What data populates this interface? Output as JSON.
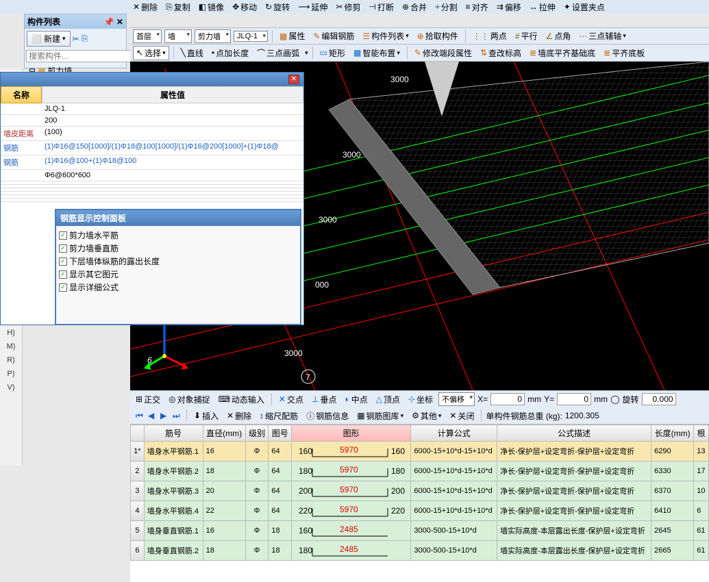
{
  "top_toolbar": {
    "items": [
      "删除",
      "复制",
      "镜像",
      "移动",
      "旋转",
      "延伸",
      "修剪",
      "打断",
      "合并",
      "分割",
      "对齐",
      "偏移",
      "拉伸",
      "设置夹点"
    ]
  },
  "side_panel": {
    "title": "构件列表",
    "new_btn": "新建",
    "search_placeholder": "搜索构件...",
    "tree_item": "剪力墙"
  },
  "toolbar2": {
    "combos": [
      "首层",
      "墙",
      "剪力墙",
      "JLQ-1"
    ],
    "buttons": [
      "属性",
      "编辑钢筋",
      "构件列表",
      "拾取构件"
    ],
    "right_buttons": [
      "两点",
      "平行",
      "点角",
      "三点辅轴"
    ]
  },
  "toolbar3": {
    "select": "选择",
    "items": [
      "直线",
      "点加长度",
      "三点画弧"
    ],
    "items2": [
      "矩形",
      "智能布置"
    ],
    "items3": [
      "修改端段属性",
      "查改标高",
      "墙底平齐基础底",
      "平齐底板"
    ]
  },
  "prop_panel": {
    "hdr_name": "名称",
    "hdr_val": "属性值",
    "rows": [
      {
        "name": "",
        "val": "JLQ-1",
        "blue": false
      },
      {
        "name": "",
        "val": "200",
        "blue": false
      },
      {
        "name": "墙皮距离",
        "val": "(100)",
        "blue": false
      },
      {
        "name": "钢筋",
        "val": "(1)Φ16@150[1000]/(1)Φ18@100[1000]/(1)Φ16@200[1000]+(1)Φ18@",
        "blue": true
      },
      {
        "name": "钢筋",
        "val": "(1)Φ16@100+(1)Φ18@100",
        "blue": true
      },
      {
        "name": "",
        "val": "Φ6@600*600",
        "blue": false
      }
    ]
  },
  "float_panel": {
    "title": "钢筋显示控制面板",
    "checks": [
      "剪力墙水平筋",
      "剪力墙垂直筋",
      "下层墙体纵筋的露出长度",
      "显示其它图元",
      "显示详细公式"
    ]
  },
  "left_strip": [
    "H)",
    "M)",
    "R)",
    "P)",
    "V)"
  ],
  "canvas_labels": {
    "d3000": "3000"
  },
  "status": {
    "btns": [
      "正交",
      "对象捕捉",
      "动态输入"
    ],
    "btns2": [
      "交点",
      "垂点",
      "中点",
      "顶点",
      "坐标"
    ],
    "combo": "不偏移",
    "x_label": "X=",
    "x_val": "0",
    "y_label": "Y=",
    "y_val": "0",
    "unit": "mm",
    "rot_label": "旋转",
    "rot_val": "0.000"
  },
  "nav": {
    "btns": [
      "插入",
      "删除",
      "缩尺配筋",
      "钢筋信息",
      "钢筋图库",
      "其他",
      "关闭"
    ],
    "total_label": "单构件钢筋总重 (kg):",
    "total_val": "1200.305"
  },
  "table": {
    "headers": [
      "",
      "筋号",
      "直径(mm)",
      "级别",
      "图号",
      "图形",
      "计算公式",
      "公式描述",
      "长度(mm)",
      "根"
    ],
    "rows": [
      {
        "idx": "1*",
        "name": "墙身水平钢筋.1",
        "d": "16",
        "lvl": "Φ",
        "img": "64",
        "l": "160",
        "mid": "5970",
        "r": "160",
        "formula": "6000-15+10*d-15+10*d",
        "desc": "净长-保护层+设定弯折-保护层+设定弯折",
        "len": "6290",
        "n": "13",
        "sel": true,
        "red": true
      },
      {
        "idx": "2",
        "name": "墙身水平钢筋.2",
        "d": "18",
        "lvl": "Φ",
        "img": "64",
        "l": "180",
        "mid": "5970",
        "r": "180",
        "formula": "6000-15+10*d-15+10*d",
        "desc": "净长-保护层+设定弯折-保护层+设定弯折",
        "len": "6330",
        "n": "17",
        "sel": false,
        "red": true
      },
      {
        "idx": "3",
        "name": "墙身水平钢筋.3",
        "d": "20",
        "lvl": "Φ",
        "img": "64",
        "l": "200",
        "mid": "5970",
        "r": "200",
        "formula": "6000-15+10*d-15+10*d",
        "desc": "净长-保护层+设定弯折-保护层+设定弯折",
        "len": "6370",
        "n": "10",
        "sel": false,
        "red": true
      },
      {
        "idx": "4",
        "name": "墙身水平钢筋.4",
        "d": "22",
        "lvl": "Φ",
        "img": "64",
        "l": "220",
        "mid": "5970",
        "r": "220",
        "formula": "6000-15+10*d-15+10*d",
        "desc": "净长-保护层+设定弯折-保护层+设定弯折",
        "len": "6410",
        "n": "6",
        "sel": false,
        "red": true
      },
      {
        "idx": "5",
        "name": "墙身垂直钢筋.1",
        "d": "16",
        "lvl": "Φ",
        "img": "18",
        "l": "160",
        "mid": "2485",
        "r": "",
        "formula": "3000-500-15+10*d",
        "desc": "墙实际高度-本层露出长度-保护层+设定弯折",
        "len": "2645",
        "n": "61",
        "sel": false,
        "red": true
      },
      {
        "idx": "6",
        "name": "墙身垂直钢筋.2",
        "d": "18",
        "lvl": "Φ",
        "img": "18",
        "l": "180",
        "mid": "2485",
        "r": "",
        "formula": "3000-500-15+10*d",
        "desc": "墙实际高度-本层露出长度-保护层+设定弯折",
        "len": "2665",
        "n": "61",
        "sel": false,
        "red": true
      }
    ]
  }
}
